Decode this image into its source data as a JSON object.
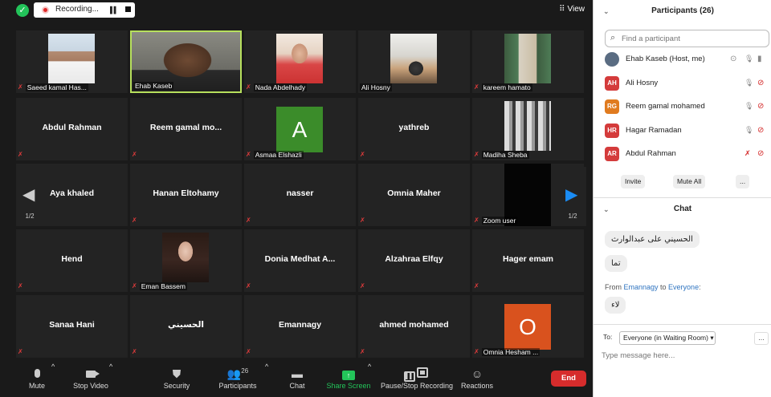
{
  "topbar": {
    "recording_label": "Recording...",
    "view_label": "View"
  },
  "grid": {
    "page_indicator": "1/2"
  },
  "tiles": [
    {
      "row": 0,
      "col": 0,
      "label": "Saeed kamal Has...",
      "muted": true,
      "photo": "man-white-shirt"
    },
    {
      "row": 0,
      "col": 1,
      "label": "Ehab Kaseb",
      "muted": false,
      "active": true,
      "photo": "man-bald"
    },
    {
      "row": 0,
      "col": 2,
      "label": "Nada Abdelhady",
      "muted": true,
      "photo": "woman-hijab"
    },
    {
      "row": 0,
      "col": 3,
      "label": "Ali Hosny",
      "muted": false,
      "photo": "man-room"
    },
    {
      "row": 0,
      "col": 4,
      "label": "kareem hamato",
      "muted": true,
      "photo": "man-standing"
    },
    {
      "row": 1,
      "col": 0,
      "center_name": "Abdul Rahman",
      "muted": true
    },
    {
      "row": 1,
      "col": 1,
      "center_name": "Reem gamal mo...",
      "muted": true
    },
    {
      "row": 1,
      "col": 2,
      "label": "Asmaa Elshazli",
      "muted": true,
      "avatar_letter": "A",
      "avatar_color": "#3b8c2a"
    },
    {
      "row": 1,
      "col": 3,
      "center_name": "yathreb",
      "muted": true
    },
    {
      "row": 1,
      "col": 4,
      "label": "Madiha Sheba",
      "muted": true,
      "photo": "bw-group"
    },
    {
      "row": 2,
      "col": 0,
      "center_name": "Aya khaled",
      "muted": true
    },
    {
      "row": 2,
      "col": 1,
      "center_name": "Hanan Eltohamy",
      "muted": true
    },
    {
      "row": 2,
      "col": 2,
      "center_name": "nasser",
      "muted": true
    },
    {
      "row": 2,
      "col": 3,
      "center_name": "Omnia Maher",
      "muted": true
    },
    {
      "row": 2,
      "col": 4,
      "label": "Zoom user",
      "muted": true,
      "photo": "black"
    },
    {
      "row": 3,
      "col": 0,
      "center_name": "Hend",
      "muted": true
    },
    {
      "row": 3,
      "col": 1,
      "label": "Eman Bassem",
      "muted": true,
      "photo": "woman-dark-hair"
    },
    {
      "row": 3,
      "col": 2,
      "center_name": "Donia Medhat A...",
      "muted": true
    },
    {
      "row": 3,
      "col": 3,
      "center_name": "Alzahraa Elfqy",
      "muted": true
    },
    {
      "row": 3,
      "col": 4,
      "center_name": "Hager emam",
      "muted": true
    },
    {
      "row": 4,
      "col": 0,
      "center_name": "Sanaa Hani",
      "muted": true
    },
    {
      "row": 4,
      "col": 1,
      "center_name": "الحسيني",
      "muted": true
    },
    {
      "row": 4,
      "col": 2,
      "center_name": "Emannagy",
      "muted": true
    },
    {
      "row": 4,
      "col": 3,
      "center_name": "ahmed mohamed",
      "muted": true
    },
    {
      "row": 4,
      "col": 4,
      "label": "Omnia Hesham ...",
      "muted": true,
      "avatar_letter": "O",
      "avatar_color": "#d9521e"
    }
  ],
  "toolbar": {
    "mute": "Mute",
    "stop_video": "Stop Video",
    "security": "Security",
    "participants": "Participants",
    "participants_count": "26",
    "chat": "Chat",
    "share_screen": "Share Screen",
    "pause_stop_recording": "Pause/Stop Recording",
    "reactions": "Reactions",
    "end": "End"
  },
  "panel": {
    "participants_title": "Participants (26)",
    "search_placeholder": "Find a participant",
    "participants": [
      {
        "initials": "",
        "name": "Ehab Kaseb (Host, me)",
        "avatar_color": "#5a6c82",
        "is_photo": true,
        "mic_muted": false,
        "video_off": false
      },
      {
        "initials": "AH",
        "name": "Ali Hosny",
        "avatar_color": "#d43b3b",
        "mic_muted": false,
        "video_off": true
      },
      {
        "initials": "RG",
        "name": "Reem gamal mohamed",
        "avatar_color": "#e07b1f",
        "mic_muted": false,
        "video_off": true
      },
      {
        "initials": "HR",
        "name": "Hagar Ramadan",
        "avatar_color": "#d43b3b",
        "mic_muted": false,
        "video_off": true
      },
      {
        "initials": "AR",
        "name": "Abdul Rahman",
        "avatar_color": "#d43b3b",
        "mic_muted": true,
        "video_off": true
      }
    ],
    "invite": "Invite",
    "mute_all": "Mute All",
    "more": "...",
    "chat_title": "Chat",
    "chat_messages": [
      {
        "text": "الحسيني على عبدالوارث"
      },
      {
        "text": "تما"
      },
      {
        "from_prefix": "From ",
        "from": "Emannagy",
        "to_prefix": " to ",
        "to": "Everyone",
        "suffix": ":",
        "text": "لاء"
      }
    ],
    "to_label": "To:",
    "to_value": "Everyone (in Waiting Room)",
    "type_placeholder": "Type message here..."
  }
}
